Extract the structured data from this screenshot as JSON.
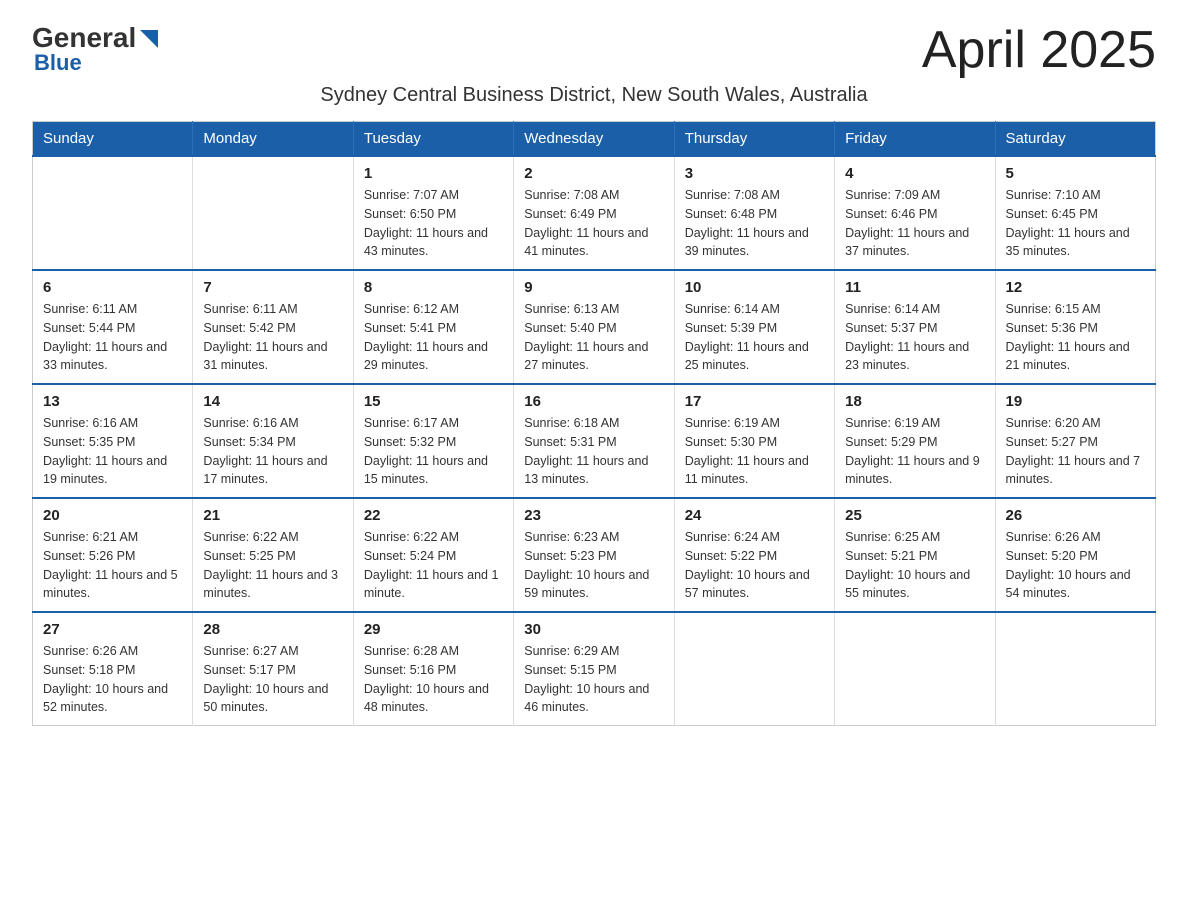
{
  "logo": {
    "part1": "General",
    "part2": "Blue"
  },
  "title": "April 2025",
  "subtitle": "Sydney Central Business District, New South Wales, Australia",
  "weekdays": [
    "Sunday",
    "Monday",
    "Tuesday",
    "Wednesday",
    "Thursday",
    "Friday",
    "Saturday"
  ],
  "weeks": [
    [
      {
        "day": "",
        "info": ""
      },
      {
        "day": "",
        "info": ""
      },
      {
        "day": "1",
        "info": "Sunrise: 7:07 AM\nSunset: 6:50 PM\nDaylight: 11 hours\nand 43 minutes."
      },
      {
        "day": "2",
        "info": "Sunrise: 7:08 AM\nSunset: 6:49 PM\nDaylight: 11 hours\nand 41 minutes."
      },
      {
        "day": "3",
        "info": "Sunrise: 7:08 AM\nSunset: 6:48 PM\nDaylight: 11 hours\nand 39 minutes."
      },
      {
        "day": "4",
        "info": "Sunrise: 7:09 AM\nSunset: 6:46 PM\nDaylight: 11 hours\nand 37 minutes."
      },
      {
        "day": "5",
        "info": "Sunrise: 7:10 AM\nSunset: 6:45 PM\nDaylight: 11 hours\nand 35 minutes."
      }
    ],
    [
      {
        "day": "6",
        "info": "Sunrise: 6:11 AM\nSunset: 5:44 PM\nDaylight: 11 hours\nand 33 minutes."
      },
      {
        "day": "7",
        "info": "Sunrise: 6:11 AM\nSunset: 5:42 PM\nDaylight: 11 hours\nand 31 minutes."
      },
      {
        "day": "8",
        "info": "Sunrise: 6:12 AM\nSunset: 5:41 PM\nDaylight: 11 hours\nand 29 minutes."
      },
      {
        "day": "9",
        "info": "Sunrise: 6:13 AM\nSunset: 5:40 PM\nDaylight: 11 hours\nand 27 minutes."
      },
      {
        "day": "10",
        "info": "Sunrise: 6:14 AM\nSunset: 5:39 PM\nDaylight: 11 hours\nand 25 minutes."
      },
      {
        "day": "11",
        "info": "Sunrise: 6:14 AM\nSunset: 5:37 PM\nDaylight: 11 hours\nand 23 minutes."
      },
      {
        "day": "12",
        "info": "Sunrise: 6:15 AM\nSunset: 5:36 PM\nDaylight: 11 hours\nand 21 minutes."
      }
    ],
    [
      {
        "day": "13",
        "info": "Sunrise: 6:16 AM\nSunset: 5:35 PM\nDaylight: 11 hours\nand 19 minutes."
      },
      {
        "day": "14",
        "info": "Sunrise: 6:16 AM\nSunset: 5:34 PM\nDaylight: 11 hours\nand 17 minutes."
      },
      {
        "day": "15",
        "info": "Sunrise: 6:17 AM\nSunset: 5:32 PM\nDaylight: 11 hours\nand 15 minutes."
      },
      {
        "day": "16",
        "info": "Sunrise: 6:18 AM\nSunset: 5:31 PM\nDaylight: 11 hours\nand 13 minutes."
      },
      {
        "day": "17",
        "info": "Sunrise: 6:19 AM\nSunset: 5:30 PM\nDaylight: 11 hours\nand 11 minutes."
      },
      {
        "day": "18",
        "info": "Sunrise: 6:19 AM\nSunset: 5:29 PM\nDaylight: 11 hours\nand 9 minutes."
      },
      {
        "day": "19",
        "info": "Sunrise: 6:20 AM\nSunset: 5:27 PM\nDaylight: 11 hours\nand 7 minutes."
      }
    ],
    [
      {
        "day": "20",
        "info": "Sunrise: 6:21 AM\nSunset: 5:26 PM\nDaylight: 11 hours\nand 5 minutes."
      },
      {
        "day": "21",
        "info": "Sunrise: 6:22 AM\nSunset: 5:25 PM\nDaylight: 11 hours\nand 3 minutes."
      },
      {
        "day": "22",
        "info": "Sunrise: 6:22 AM\nSunset: 5:24 PM\nDaylight: 11 hours\nand 1 minute."
      },
      {
        "day": "23",
        "info": "Sunrise: 6:23 AM\nSunset: 5:23 PM\nDaylight: 10 hours\nand 59 minutes."
      },
      {
        "day": "24",
        "info": "Sunrise: 6:24 AM\nSunset: 5:22 PM\nDaylight: 10 hours\nand 57 minutes."
      },
      {
        "day": "25",
        "info": "Sunrise: 6:25 AM\nSunset: 5:21 PM\nDaylight: 10 hours\nand 55 minutes."
      },
      {
        "day": "26",
        "info": "Sunrise: 6:26 AM\nSunset: 5:20 PM\nDaylight: 10 hours\nand 54 minutes."
      }
    ],
    [
      {
        "day": "27",
        "info": "Sunrise: 6:26 AM\nSunset: 5:18 PM\nDaylight: 10 hours\nand 52 minutes."
      },
      {
        "day": "28",
        "info": "Sunrise: 6:27 AM\nSunset: 5:17 PM\nDaylight: 10 hours\nand 50 minutes."
      },
      {
        "day": "29",
        "info": "Sunrise: 6:28 AM\nSunset: 5:16 PM\nDaylight: 10 hours\nand 48 minutes."
      },
      {
        "day": "30",
        "info": "Sunrise: 6:29 AM\nSunset: 5:15 PM\nDaylight: 10 hours\nand 46 minutes."
      },
      {
        "day": "",
        "info": ""
      },
      {
        "day": "",
        "info": ""
      },
      {
        "day": "",
        "info": ""
      }
    ]
  ]
}
